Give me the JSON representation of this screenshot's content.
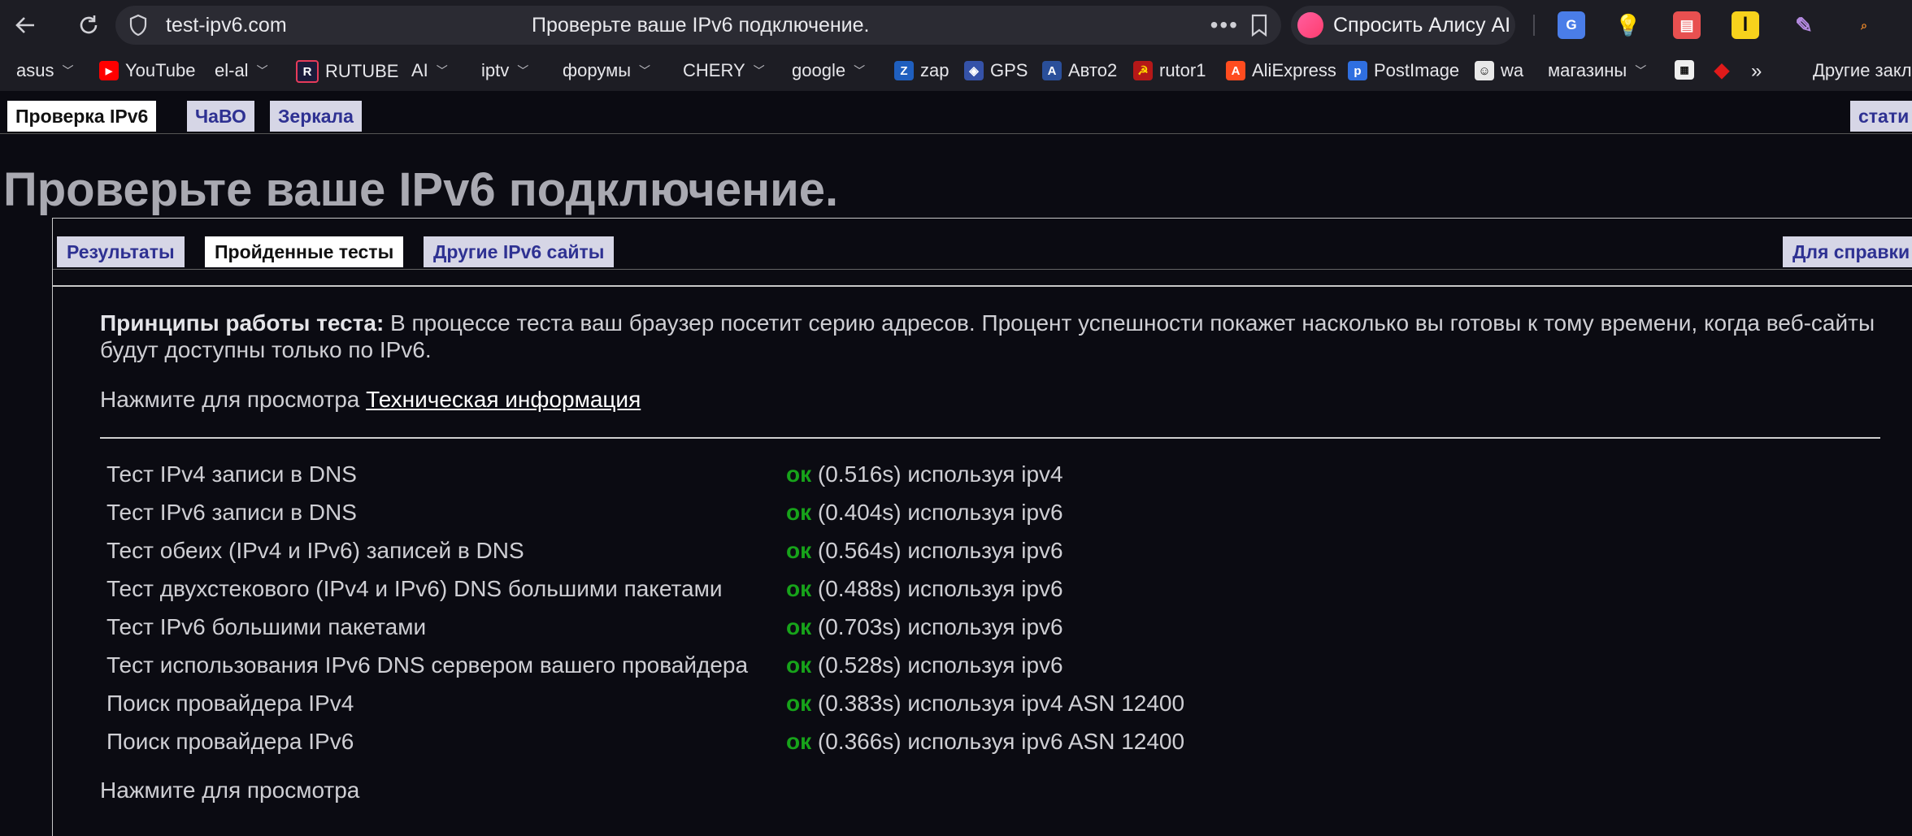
{
  "browser": {
    "domain": "test-ipv6.com",
    "tab_title": "Проверьте ваше IPv6 подключение.",
    "alice_label": "Спросить Алису AI"
  },
  "bookmarks": [
    {
      "label": "asus",
      "dropdown": true
    },
    {
      "label": "YouTube",
      "icon": "youtube-icon"
    },
    {
      "label": "el-al",
      "dropdown": true
    },
    {
      "label": "RUTUBE",
      "icon": "rutube-icon"
    },
    {
      "label": "AI",
      "dropdown": true
    },
    {
      "label": "iptv",
      "dropdown": true
    },
    {
      "label": "форумы",
      "dropdown": true
    },
    {
      "label": "CHERY",
      "dropdown": true
    },
    {
      "label": "google",
      "dropdown": true
    },
    {
      "label": "zap",
      "icon": "zap-icon"
    },
    {
      "label": "GPS",
      "icon": "gps-icon"
    },
    {
      "label": "Авто2",
      "icon": "auto-icon"
    },
    {
      "label": "rutor1",
      "icon": "rutor-icon"
    },
    {
      "label": "AliExpress",
      "icon": "aliexpress-icon"
    },
    {
      "label": "PostImage",
      "icon": "postimage-icon"
    },
    {
      "label": "wa",
      "icon": "waze-icon"
    },
    {
      "label": "магазины",
      "dropdown": true
    },
    {
      "label": "Другие закл"
    }
  ],
  "site_tabs": {
    "check": "Проверка IPv6",
    "faq": "ЧаВО",
    "mirrors": "Зеркала",
    "stats": "стати"
  },
  "page": {
    "title": "Проверьте ваше IPv6 подключение.",
    "sub_tabs": {
      "results": "Результаты",
      "tests": "Пройденные тесты",
      "other": "Другие IPv6 сайты",
      "help": "Для справки"
    },
    "principles_label": "Принципы работы теста:",
    "principles_text": " В процессе теста ваш браузер посетит серию адресов. Процент успешности покажет насколько вы готовы к тому времени, когда веб-сайты будут доступны только по IPv6.",
    "tech_prefix": "Нажмите для просмотра ",
    "tech_link": "Техническая информация",
    "footer_text": "Нажмите для просмотра"
  },
  "tests": [
    {
      "name": "Тест IPv4 записи в DNS",
      "status": "ок",
      "detail": "(0.516s) используя ipv4"
    },
    {
      "name": "Тест IPv6 записи в DNS",
      "status": "ок",
      "detail": "(0.404s) используя ipv6"
    },
    {
      "name": "Тест обеих (IPv4 и IPv6) записей в DNS",
      "status": "ок",
      "detail": "(0.564s) используя ipv6"
    },
    {
      "name": "Тест двухстекового (IPv4 и IPv6) DNS большими пакетами",
      "status": "ок",
      "detail": "(0.488s) используя ipv6"
    },
    {
      "name": "Тест IPv6 большими пакетами",
      "status": "ок",
      "detail": "(0.703s) используя ipv6"
    },
    {
      "name": "Тест использования IPv6 DNS сервером вашего провайдера",
      "status": "ок",
      "detail": "(0.528s) используя ipv6"
    },
    {
      "name": "Поиск провайдера IPv4",
      "status": "ок",
      "detail": "(0.383s) используя ipv4 ASN 12400"
    },
    {
      "name": "Поиск провайдера IPv6",
      "status": "ок",
      "detail": "(0.366s) используя ipv6 ASN 12400"
    }
  ],
  "colors": {
    "ok": "#17a31a",
    "tab_bg": "#d6d6e6",
    "tab_text": "#2e3192"
  }
}
